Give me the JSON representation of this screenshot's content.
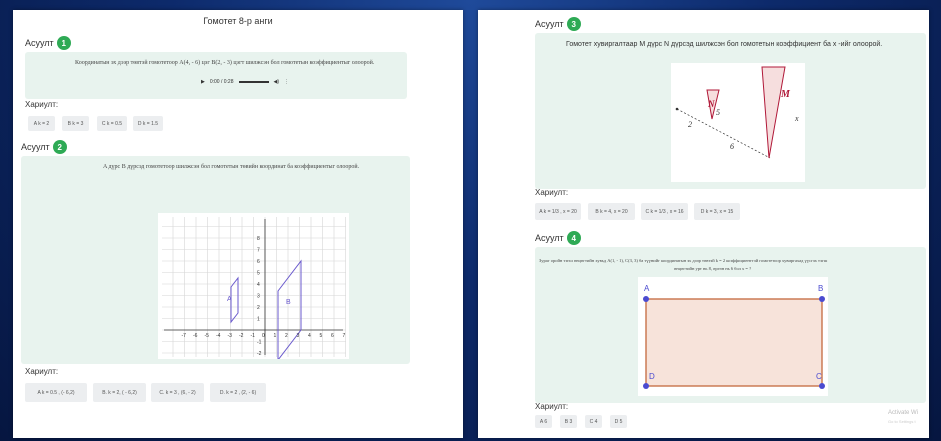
{
  "doc": {
    "title": "Гомотет 8-р анги"
  },
  "q1": {
    "label": "Асуулт",
    "num": "1",
    "text": "Координатын эх дээр төвтэй гомотетоор A(4, - 6) цэг B(2, - 3) цэгт шилжсэн бол гомотетын коэффициентыг олоорой.",
    "audio_time": "0:00 / 0:28",
    "answer_label": "Хариулт:",
    "options": [
      "A k = 2",
      "B k = 3",
      "C k = 0.5",
      "D k = 1.5"
    ]
  },
  "q2": {
    "label": "Асуулт",
    "num": "2",
    "text": "A дүрс  B дүрсэд гомотетоор шилжсэн бол  гомотетын төвийн координат ба коэффициентыг олоорой.",
    "answer_label": "Хариулт:",
    "options": [
      "A k = 0.5 , (- 6,2)",
      "B. k = 2, ( - 6,2)",
      "C. k = 3 , (6, - 2)",
      "D. k = 2 , (2, - 6)"
    ],
    "grid": {
      "x_ticks": [
        "-7",
        "-6",
        "-5",
        "-4",
        "-3",
        "-2",
        "-1",
        "0",
        "1",
        "2",
        "3",
        "4",
        "5",
        "6",
        "7"
      ],
      "y_ticks": [
        "8",
        "7",
        "6",
        "5",
        "4",
        "3",
        "2",
        "1",
        "-1",
        "-2"
      ],
      "shape_a": "A",
      "shape_b": "B"
    }
  },
  "q3": {
    "label": "Асуулт",
    "num": "3",
    "text": "Гомотет хувиргалтаар M дүрс N дүрсэд шилжсэн бол гомотетын  коэффициент ба x -ийг олоорой.",
    "answer_label": "Хариулт:",
    "options": [
      "A  k = 1/3 , x = 20",
      "B k = 4, x = 20",
      "C  k = 1/3 , x = 16",
      "D k = 3, x = 15"
    ],
    "figure": {
      "n": "N",
      "m": "M",
      "five": "5",
      "x": "x",
      "two": "2",
      "six": "6"
    }
  },
  "q4": {
    "label": "Асуулт",
    "num": "4",
    "text1": "Зураг оройн тэгш өнцөгтийн хувьд  A(1, - 1), C(3, 3)  ба түүнийг координатын эх дээр төвтэй  k = 2 коэффициенттэй гомотетоор хувиргахад үүсгэх тэгш",
    "text2": "өнцөгтийн урт нь 8, өргөн нь 6  бол  x = ?",
    "answer_label": "Хариулт:",
    "options": [
      "A 6",
      "B 3",
      "C 4",
      "D 5"
    ],
    "corners": {
      "a": "A",
      "b": "B",
      "c": "C",
      "d": "D"
    }
  },
  "watermark": {
    "title": "Activate Wi",
    "sub": "Go to Settings t"
  }
}
